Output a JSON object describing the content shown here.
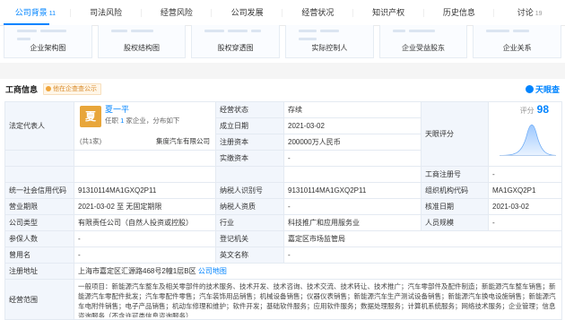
{
  "nav": {
    "tabs": [
      {
        "label": "公司背景",
        "count": "11"
      },
      {
        "label": "司法风险",
        "count": ""
      },
      {
        "label": "经营风险",
        "count": ""
      },
      {
        "label": "公司发展",
        "count": ""
      },
      {
        "label": "经营状况",
        "count": ""
      },
      {
        "label": "知识产权",
        "count": ""
      },
      {
        "label": "历史信息",
        "count": ""
      },
      {
        "label": "讨论",
        "count": "19"
      }
    ]
  },
  "cards": [
    "企业架构图",
    "股权结构图",
    "股权穿透图",
    "实际控制人",
    "企业受益股东",
    "企业关系"
  ],
  "section": {
    "title": "工商信息",
    "note": "他在企查查公示",
    "brand": "天眼查"
  },
  "rep": {
    "label": "法定代表人",
    "avatar": "夏",
    "name": "夏一平",
    "sub_prefix": "任职",
    "sub_count": "1",
    "sub_suffix": "家企业，分布如下",
    "related": "(共1家)",
    "company": "集度汽车有限公司"
  },
  "score": {
    "label": "天眼评分",
    "prefix": "评分",
    "value": "98"
  },
  "rows": {
    "r1": {
      "k1": "经营状态",
      "v1": "存续"
    },
    "r2": {
      "k1": "成立日期",
      "v1": "2021-03-02"
    },
    "r3": {
      "k1": "注册资本",
      "v1": "200000万人民币"
    },
    "r4": {
      "k1": "实缴资本",
      "v1": "-",
      "k2": "工商注册号",
      "v2": "-"
    },
    "r5": {
      "k0": "统一社会信用代码",
      "v0": "91310114MA1GXQ2P11",
      "k1": "纳税人识别号",
      "v1": "91310114MA1GXQ2P11",
      "k2": "组织机构代码",
      "v2": "MA1GXQ2P1"
    },
    "r6": {
      "k0": "营业期限",
      "v0": "2021-03-02  至  无固定期限",
      "k1": "纳税人资质",
      "v1": "-",
      "k2": "核准日期",
      "v2": "2021-03-02"
    },
    "r7": {
      "k0": "公司类型",
      "v0": "有限责任公司（自然人投资或控股）",
      "k1": "行业",
      "v1": "科技推广和应用服务业",
      "k2": "人员规模",
      "v2": "-"
    },
    "r8": {
      "k0": "参保人数",
      "v0": "-",
      "k1": "登记机关",
      "v1": "嘉定区市场监管局"
    },
    "r9": {
      "k0": "曾用名",
      "v0": "-",
      "k1": "英文名称",
      "v1": "-"
    },
    "r10": {
      "k0": "注册地址",
      "v0": "上海市嘉定区汇源路468号2幢1层B区",
      "link": "公司地图"
    },
    "r11": {
      "k0": "经营范围",
      "v0": "一般项目：新能源汽车整车及相关零部件的技术服务、技术开发、技术咨询、技术交流、技术转让、技术推广；汽车零部件及配件制造；新能源汽车整车销售；新能源汽车零配件批发；汽车零配件零售；汽车装饰用品销售；机械设备销售；仪器仪表销售；新能源汽车生产测试设备销售；新能源汽车换电设施销售；新能源汽车电附件销售；电子产品销售；机动车修理和维护；软件开发；基础软件服务；应用软件服务；数据处理服务；计算机系统服务；网络技术服务；企业管理；信息咨询服务（不含许可类信息咨询服务）"
    }
  }
}
